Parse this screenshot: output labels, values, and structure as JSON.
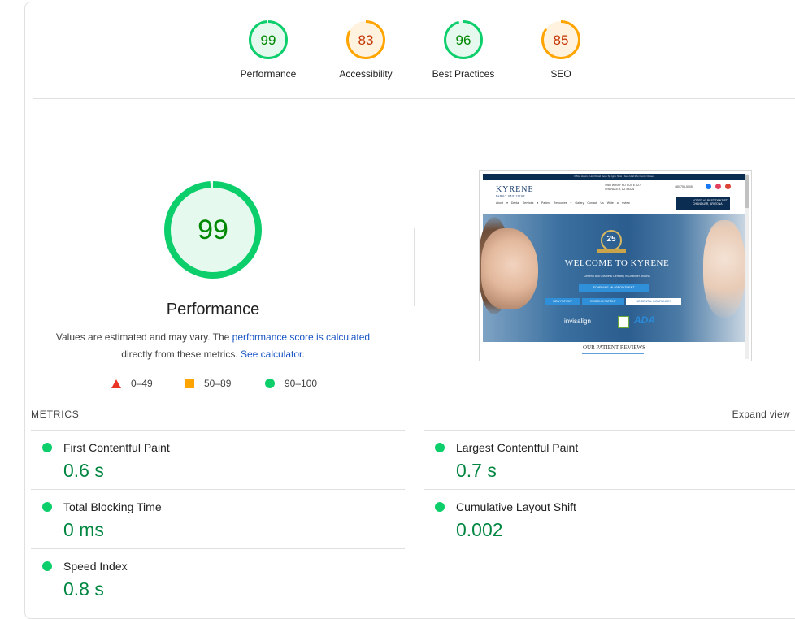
{
  "categories": [
    {
      "score": "99",
      "label": "Performance",
      "status": "pass",
      "fraction": 0.99
    },
    {
      "score": "83",
      "label": "Accessibility",
      "status": "average",
      "fraction": 0.83
    },
    {
      "score": "96",
      "label": "Best Practices",
      "status": "pass",
      "fraction": 0.96
    },
    {
      "score": "85",
      "label": "SEO",
      "status": "average",
      "fraction": 0.85
    }
  ],
  "colors": {
    "pass": "#0cce6b",
    "pass_text": "#008800",
    "pass_bg": "#e6f9ee",
    "average": "#ffa400",
    "average_text": "#c33300",
    "average_bg": "#fff3e0",
    "fail": "#eb3323",
    "metric_value": "#018642",
    "link": "#1a56c4"
  },
  "performance": {
    "score": "99",
    "fraction": 0.99,
    "title": "Performance",
    "desc_prefix": "Values are estimated and may vary. The ",
    "desc_link1": "performance score is calculated",
    "desc_middle": " directly from these metrics. ",
    "desc_link2": "See calculator",
    "desc_suffix": "."
  },
  "legend": [
    {
      "shape": "triangle-icon",
      "range": "0–49"
    },
    {
      "shape": "square-icon",
      "range": "50–89"
    },
    {
      "shape": "circle-icon",
      "range": "90–100"
    }
  ],
  "screenshot": {
    "topbar_text": "Office Hours • Holi Rewd Ave • Sp Ign • Now • Gen Ural Info Cunt • Closed",
    "logo": "KYRENE",
    "logo_sub": "FAMILY DENTISTRY",
    "address_line1": "4988 W RAY RD SUITE 627",
    "address_line2": "CHANDLER, AZ 85226",
    "phone": "480-753-5005",
    "nav": "About ▾   Dental Services ▾   Patient Resources ▾   Gallery   Contact Us   Write a review",
    "badge": "VOTED #1 BEST DENTIST\nCHANDLER, ARIZONA",
    "anniversary": "25",
    "welcome": "WELCOME TO KYRENE",
    "subtitle": "General and Cosmetic Dentistry in Chandler Arizona",
    "btn_schedule": "SCHEDULE AN APPOINTMENT",
    "btn_new": "NEW PATIENT",
    "btn_existing": "EXISTING PATIENT",
    "btn_insurance": "NO DENTAL INSURANCE?",
    "logo_invisalign": "invisalign",
    "logo_ada": "ADA",
    "reviews": "OUR PATIENT REVIEWS"
  },
  "metrics": {
    "header": "METRICS",
    "expand": "Expand view",
    "items": [
      {
        "label": "First Contentful Paint",
        "value": "0.6 s"
      },
      {
        "label": "Largest Contentful Paint",
        "value": "0.7 s"
      },
      {
        "label": "Total Blocking Time",
        "value": "0 ms"
      },
      {
        "label": "Cumulative Layout Shift",
        "value": "0.002"
      },
      {
        "label": "Speed Index",
        "value": "0.8 s"
      }
    ]
  }
}
